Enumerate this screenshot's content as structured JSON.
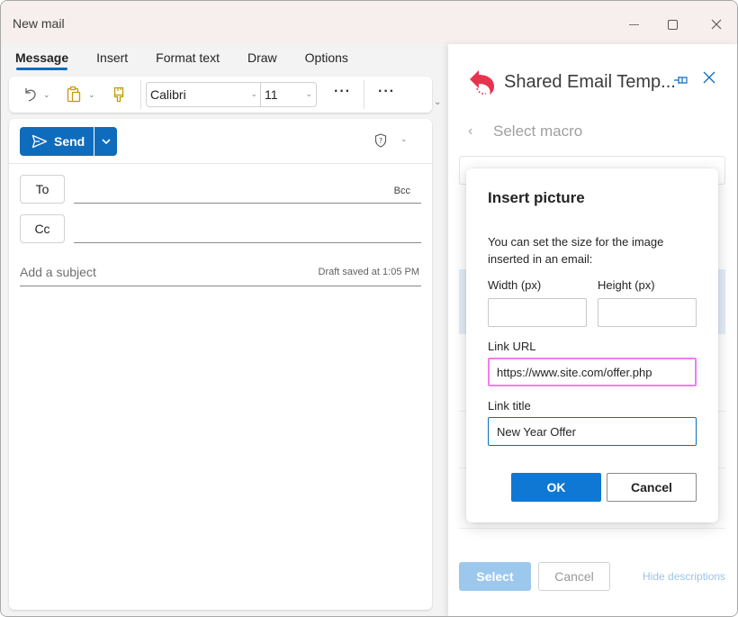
{
  "window": {
    "title": "New mail",
    "controls": {
      "minimize": "minimize",
      "maximize": "maximize",
      "close": "close"
    }
  },
  "ribbon": {
    "tabs": [
      {
        "label": "Message",
        "active": true
      },
      {
        "label": "Insert",
        "active": false
      },
      {
        "label": "Format text",
        "active": false
      },
      {
        "label": "Draw",
        "active": false
      },
      {
        "label": "Options",
        "active": false
      }
    ],
    "font_family": "Calibri",
    "font_size": "11",
    "more_label": "···",
    "icons": [
      "undo-icon",
      "paste-icon",
      "format-painter-icon"
    ]
  },
  "compose": {
    "send_label": "Send",
    "to_label": "To",
    "cc_label": "Cc",
    "bcc_label": "Bcc",
    "to_value": "",
    "cc_value": "",
    "subject_placeholder": "Add a subject",
    "draft_status": "Draft saved at 1:05 PM",
    "body": ""
  },
  "addin": {
    "title": "Shared Email Temp...",
    "back_label": "Select macro",
    "select_label": "Select",
    "cancel_label": "Cancel",
    "hide_descriptions_label": "Hide descriptions",
    "logo_color": "#e8334e"
  },
  "dialog": {
    "title": "Insert picture",
    "description": "You can set the size for the image inserted in an email:",
    "width_label": "Width (px)",
    "width_value": "",
    "height_label": "Height (px)",
    "height_value": "",
    "link_url_label": "Link URL",
    "link_url_value": "https://www.site.com/offer.php",
    "link_title_label": "Link title",
    "link_title_value": "New Year Offer",
    "ok_label": "OK",
    "cancel_label": "Cancel"
  },
  "colors": {
    "accent": "#0f6cbd",
    "ok_button": "#0f78d4",
    "url_highlight": "#f17df0",
    "select_disabled": "#9cc8ee"
  }
}
